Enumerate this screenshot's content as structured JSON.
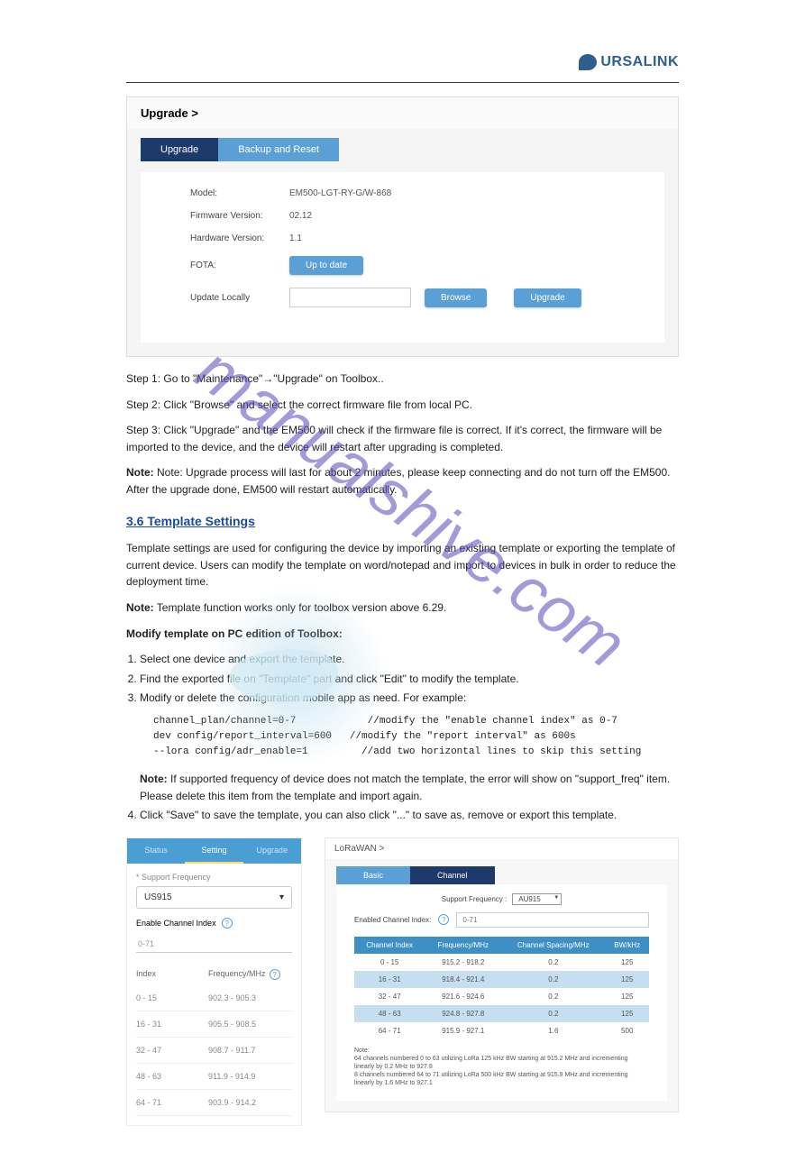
{
  "brand": "URSALINK",
  "watermark": "manualshive.com",
  "upgrade_panel": {
    "title": "Upgrade >",
    "tabs": {
      "upgrade": "Upgrade",
      "backup": "Backup and Reset"
    },
    "rows": {
      "model_label": "Model:",
      "model_value": "EM500-LGT-RY-G/W-868",
      "fw_label": "Firmware Version:",
      "fw_value": "02.12",
      "hw_label": "Hardware Version:",
      "hw_value": "1.1",
      "fota_label": "FOTA:",
      "fota_btn": "Up to date",
      "update_label": "Update Locally",
      "browse_btn": "Browse",
      "upgrade_btn": "Upgrade"
    }
  },
  "text": {
    "p1": "Step 1: Go to \"Maintenance\"→\"Upgrade\" on Toolbox..",
    "p2": "Step 2: Click \"Browse\" and select the correct firmware file from local PC.",
    "p3": "Step 3: Click \"Upgrade\" and the EM500 will check if the firmware file is correct. If it's correct, the firmware will be imported to the device, and the device will restart after upgrading is completed.",
    "p4": "Note: Upgrade process will last for about 2 minutes, please keep connecting and do not turn off the EM500. After the upgrade done, EM500 will restart automatically.",
    "heading": "3.6 Template Settings",
    "p5": "Template settings are used for configuring the device by importing an existing template or exporting the template of current device. Users can modify the template on word/notepad and import to devices in bulk in order to reduce the deployment time.",
    "p6_bold": "Note:",
    "p6": "Template function works only for toolbox version above 6.29.",
    "p7_bold": "Modify template on PC edition of Toolbox:",
    "li1": "Select one device and export the template.",
    "li2": "Find the exported file on \"Template\" part and click \"Edit\" to modify the template.",
    "li3": "Modify or delete the configuration mobile app as need. For example:",
    "cmd1": "channel_plan/channel=0-7",
    "cmd1_comm": "//modify the \"enable channel index\" as 0-7",
    "cmd2": "dev config/report_interval=600",
    "cmd2_comm": "//modify the \"report interval\" as 600s",
    "cmd3_prefix": "--",
    "cmd3": "lora config/adr_enable=1",
    "cmd3_comm": "//add two horizontal lines to skip this setting",
    "li4_bold": "Note:",
    "li4": "If supported frequency of device does not match the template, the error will show on \"support_freq\" item. Please delete this item from the template and import again.",
    "li5": "Click \"Save\" to save the template, you can also click \"...\" to save as, remove or export this template."
  },
  "mobile": {
    "tabs": {
      "status": "Status",
      "setting": "Setting",
      "upgrade": "Upgrade"
    },
    "sf_label": "Support Frequency",
    "sf_value": "US915",
    "eci_label": "Enable Channel Index",
    "eci_value": "0-71",
    "head_index": "Index",
    "head_freq": "Frequency/MHz",
    "rows": [
      {
        "idx": "0 - 15",
        "freq": "902.3 - 905.3"
      },
      {
        "idx": "16 - 31",
        "freq": "905.5 - 908.5"
      },
      {
        "idx": "32 - 47",
        "freq": "908.7 - 911.7"
      },
      {
        "idx": "48 - 63",
        "freq": "911.9 - 914.9"
      },
      {
        "idx": "64 - 71",
        "freq": "903.9 - 914.2"
      }
    ]
  },
  "channel": {
    "title": "LoRaWAN >",
    "tabs": {
      "basic": "Basic",
      "channel": "Channel"
    },
    "sf_label": "Support Frequency :",
    "sf_value": "AU915",
    "eci_label": "Enabled Channel Index:",
    "eci_value": "0-71",
    "th1": "Channel Index",
    "th2": "Frequency/MHz",
    "th3": "Channel Spacing/MHz",
    "th4": "BW/kHz",
    "rows": [
      {
        "ci": "0 - 15",
        "fr": "915.2 - 918.2",
        "sp": "0.2",
        "bw": "125"
      },
      {
        "ci": "16 - 31",
        "fr": "918.4 - 921.4",
        "sp": "0.2",
        "bw": "125"
      },
      {
        "ci": "32 - 47",
        "fr": "921.6 - 924.6",
        "sp": "0.2",
        "bw": "125"
      },
      {
        "ci": "48 - 63",
        "fr": "924.8 - 927.8",
        "sp": "0.2",
        "bw": "125"
      },
      {
        "ci": "64 - 71",
        "fr": "915.9 - 927.1",
        "sp": "1.6",
        "bw": "500"
      }
    ],
    "note_label": "Note:",
    "note1": "64 channels numbered 0 to 63 utilizing LoRa 125 kHz BW starting at 915.2 MHz and incrementing linearly by 0.2 MHz to 927.8",
    "note2": "8 channels numbered 64 to 71 utilizing LoRa 500 kHz BW starting at 915.9 MHz and incrementing linearly by 1.6 MHz to 927.1"
  }
}
